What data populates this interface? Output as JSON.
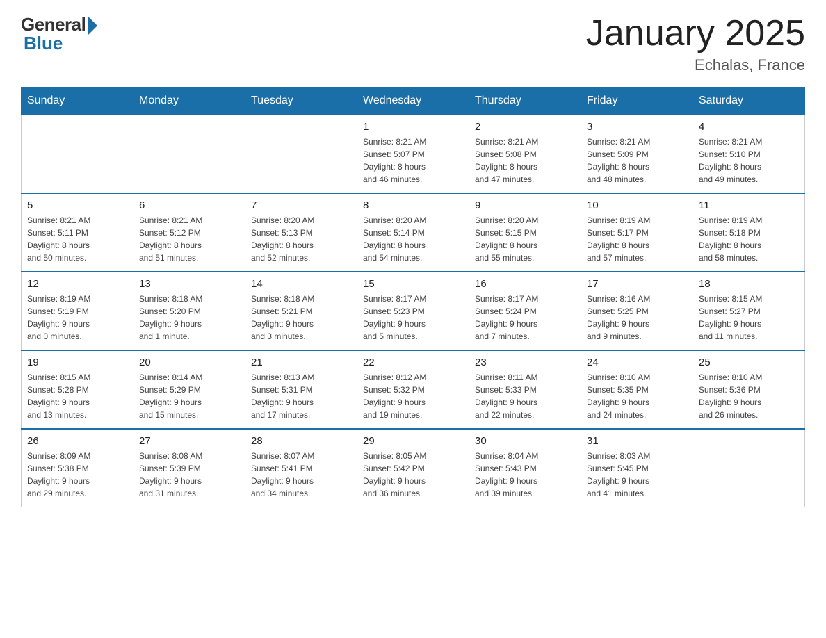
{
  "header": {
    "logo_general": "General",
    "logo_blue": "Blue",
    "month_year": "January 2025",
    "location": "Echalas, France"
  },
  "weekdays": [
    "Sunday",
    "Monday",
    "Tuesday",
    "Wednesday",
    "Thursday",
    "Friday",
    "Saturday"
  ],
  "weeks": [
    [
      {
        "day": "",
        "info": ""
      },
      {
        "day": "",
        "info": ""
      },
      {
        "day": "",
        "info": ""
      },
      {
        "day": "1",
        "info": "Sunrise: 8:21 AM\nSunset: 5:07 PM\nDaylight: 8 hours\nand 46 minutes."
      },
      {
        "day": "2",
        "info": "Sunrise: 8:21 AM\nSunset: 5:08 PM\nDaylight: 8 hours\nand 47 minutes."
      },
      {
        "day": "3",
        "info": "Sunrise: 8:21 AM\nSunset: 5:09 PM\nDaylight: 8 hours\nand 48 minutes."
      },
      {
        "day": "4",
        "info": "Sunrise: 8:21 AM\nSunset: 5:10 PM\nDaylight: 8 hours\nand 49 minutes."
      }
    ],
    [
      {
        "day": "5",
        "info": "Sunrise: 8:21 AM\nSunset: 5:11 PM\nDaylight: 8 hours\nand 50 minutes."
      },
      {
        "day": "6",
        "info": "Sunrise: 8:21 AM\nSunset: 5:12 PM\nDaylight: 8 hours\nand 51 minutes."
      },
      {
        "day": "7",
        "info": "Sunrise: 8:20 AM\nSunset: 5:13 PM\nDaylight: 8 hours\nand 52 minutes."
      },
      {
        "day": "8",
        "info": "Sunrise: 8:20 AM\nSunset: 5:14 PM\nDaylight: 8 hours\nand 54 minutes."
      },
      {
        "day": "9",
        "info": "Sunrise: 8:20 AM\nSunset: 5:15 PM\nDaylight: 8 hours\nand 55 minutes."
      },
      {
        "day": "10",
        "info": "Sunrise: 8:19 AM\nSunset: 5:17 PM\nDaylight: 8 hours\nand 57 minutes."
      },
      {
        "day": "11",
        "info": "Sunrise: 8:19 AM\nSunset: 5:18 PM\nDaylight: 8 hours\nand 58 minutes."
      }
    ],
    [
      {
        "day": "12",
        "info": "Sunrise: 8:19 AM\nSunset: 5:19 PM\nDaylight: 9 hours\nand 0 minutes."
      },
      {
        "day": "13",
        "info": "Sunrise: 8:18 AM\nSunset: 5:20 PM\nDaylight: 9 hours\nand 1 minute."
      },
      {
        "day": "14",
        "info": "Sunrise: 8:18 AM\nSunset: 5:21 PM\nDaylight: 9 hours\nand 3 minutes."
      },
      {
        "day": "15",
        "info": "Sunrise: 8:17 AM\nSunset: 5:23 PM\nDaylight: 9 hours\nand 5 minutes."
      },
      {
        "day": "16",
        "info": "Sunrise: 8:17 AM\nSunset: 5:24 PM\nDaylight: 9 hours\nand 7 minutes."
      },
      {
        "day": "17",
        "info": "Sunrise: 8:16 AM\nSunset: 5:25 PM\nDaylight: 9 hours\nand 9 minutes."
      },
      {
        "day": "18",
        "info": "Sunrise: 8:15 AM\nSunset: 5:27 PM\nDaylight: 9 hours\nand 11 minutes."
      }
    ],
    [
      {
        "day": "19",
        "info": "Sunrise: 8:15 AM\nSunset: 5:28 PM\nDaylight: 9 hours\nand 13 minutes."
      },
      {
        "day": "20",
        "info": "Sunrise: 8:14 AM\nSunset: 5:29 PM\nDaylight: 9 hours\nand 15 minutes."
      },
      {
        "day": "21",
        "info": "Sunrise: 8:13 AM\nSunset: 5:31 PM\nDaylight: 9 hours\nand 17 minutes."
      },
      {
        "day": "22",
        "info": "Sunrise: 8:12 AM\nSunset: 5:32 PM\nDaylight: 9 hours\nand 19 minutes."
      },
      {
        "day": "23",
        "info": "Sunrise: 8:11 AM\nSunset: 5:33 PM\nDaylight: 9 hours\nand 22 minutes."
      },
      {
        "day": "24",
        "info": "Sunrise: 8:10 AM\nSunset: 5:35 PM\nDaylight: 9 hours\nand 24 minutes."
      },
      {
        "day": "25",
        "info": "Sunrise: 8:10 AM\nSunset: 5:36 PM\nDaylight: 9 hours\nand 26 minutes."
      }
    ],
    [
      {
        "day": "26",
        "info": "Sunrise: 8:09 AM\nSunset: 5:38 PM\nDaylight: 9 hours\nand 29 minutes."
      },
      {
        "day": "27",
        "info": "Sunrise: 8:08 AM\nSunset: 5:39 PM\nDaylight: 9 hours\nand 31 minutes."
      },
      {
        "day": "28",
        "info": "Sunrise: 8:07 AM\nSunset: 5:41 PM\nDaylight: 9 hours\nand 34 minutes."
      },
      {
        "day": "29",
        "info": "Sunrise: 8:05 AM\nSunset: 5:42 PM\nDaylight: 9 hours\nand 36 minutes."
      },
      {
        "day": "30",
        "info": "Sunrise: 8:04 AM\nSunset: 5:43 PM\nDaylight: 9 hours\nand 39 minutes."
      },
      {
        "day": "31",
        "info": "Sunrise: 8:03 AM\nSunset: 5:45 PM\nDaylight: 9 hours\nand 41 minutes."
      },
      {
        "day": "",
        "info": ""
      }
    ]
  ]
}
